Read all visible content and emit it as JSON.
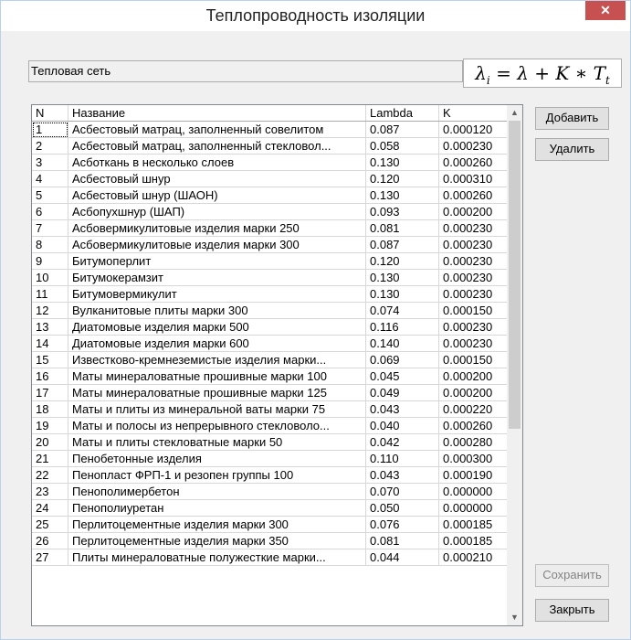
{
  "window": {
    "title": "Теплопроводность изоляции",
    "close_label": "✕"
  },
  "section_label": "Тепловая сеть",
  "formula": {
    "lhs": "λ",
    "lhs_sub": "i",
    "rhs": "= λ + K ∗ T",
    "rhs_sub": "t"
  },
  "table": {
    "headers": [
      "N",
      "Название",
      "Lambda",
      "K"
    ],
    "rows": [
      [
        "1",
        "Асбестовый матрац, заполненный совелитом",
        "0.087",
        "0.000120"
      ],
      [
        "2",
        "Асбестовый матрац, заполненный стекловол...",
        "0.058",
        "0.000230"
      ],
      [
        "3",
        "Асботкань в несколько слоев",
        "0.130",
        "0.000260"
      ],
      [
        "4",
        "Асбестовый шнур",
        "0.120",
        "0.000310"
      ],
      [
        "5",
        "Асбестовый шнур (ШАОН)",
        "0.130",
        "0.000260"
      ],
      [
        "6",
        "Асбопухшнур (ШАП)",
        "0.093",
        "0.000200"
      ],
      [
        "7",
        "Асбовермикулитовые изделия марки 250",
        "0.081",
        "0.000230"
      ],
      [
        "8",
        "Асбовермикулитовые изделия марки 300",
        "0.087",
        "0.000230"
      ],
      [
        "9",
        "Битумоперлит",
        "0.120",
        "0.000230"
      ],
      [
        "10",
        "Битумокерамзит",
        "0.130",
        "0.000230"
      ],
      [
        "11",
        "Битумовермикулит",
        "0.130",
        "0.000230"
      ],
      [
        "12",
        "Вулканитовые плиты марки 300",
        "0.074",
        "0.000150"
      ],
      [
        "13",
        "Диатомовые изделия марки 500",
        "0.116",
        "0.000230"
      ],
      [
        "14",
        "Диатомовые изделия марки 600",
        "0.140",
        "0.000230"
      ],
      [
        "15",
        "Известково-кремнеземистые изделия марки...",
        "0.069",
        "0.000150"
      ],
      [
        "16",
        "Маты минераловатные прошивные марки 100",
        "0.045",
        "0.000200"
      ],
      [
        "17",
        "Маты минераловатные прошивные марки 125",
        "0.049",
        "0.000200"
      ],
      [
        "18",
        "Маты и плиты из минеральной ваты марки 75",
        "0.043",
        "0.000220"
      ],
      [
        "19",
        "Маты и полосы из непрерывного стекловоло...",
        "0.040",
        "0.000260"
      ],
      [
        "20",
        "Маты и плиты стекловатные марки 50",
        "0.042",
        "0.000280"
      ],
      [
        "21",
        "Пенобетонные изделия",
        "0.110",
        "0.000300"
      ],
      [
        "22",
        "Пенопласт ФРП-1 и резопен группы 100",
        "0.043",
        "0.000190"
      ],
      [
        "23",
        "Пенополимербетон",
        "0.070",
        "0.000000"
      ],
      [
        "24",
        "Пенополиуретан",
        "0.050",
        "0.000000"
      ],
      [
        "25",
        "Перлитоцементные изделия марки 300",
        "0.076",
        "0.000185"
      ],
      [
        "26",
        "Перлитоцементные изделия марки 350",
        "0.081",
        "0.000185"
      ],
      [
        "27",
        "Плиты минераловатные полужесткие марки...",
        "0.044",
        "0.000210"
      ]
    ]
  },
  "buttons": {
    "add": "Добавить",
    "delete": "Удалить",
    "save": "Сохранить",
    "close": "Закрыть"
  },
  "scroll": {
    "up_arrow": "▲",
    "down_arrow": "▼"
  }
}
